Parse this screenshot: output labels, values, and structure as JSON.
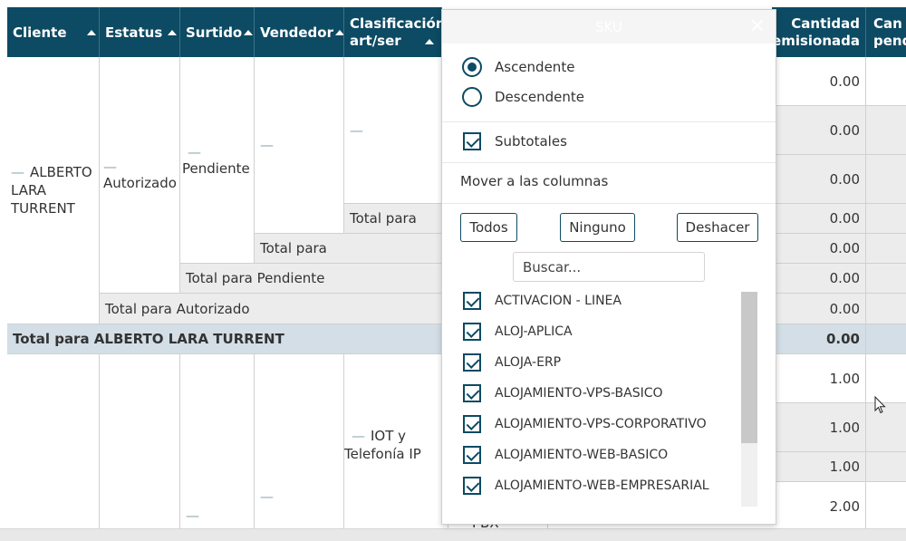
{
  "headers": [
    {
      "key": "cliente",
      "label": "Cliente"
    },
    {
      "key": "estatus",
      "label": "Estatus"
    },
    {
      "key": "surtido",
      "label": "Surtido"
    },
    {
      "key": "vendedor",
      "label": "Vendedor"
    },
    {
      "key": "clasificacion",
      "label": "Clasificación art/ser"
    },
    {
      "key": "cant_rem",
      "label": "Cantidad remisionada"
    },
    {
      "key": "cant_pend",
      "label": "Can pend"
    }
  ],
  "rows": {
    "cliente_name": "ALBERTO LARA TURRENT",
    "estatus_value": "Autorizado",
    "surtido_value": "Pendiente",
    "total_para_1": "Total para",
    "total_para_2": "Total para",
    "total_pendiente": "Total para Pendiente",
    "total_autorizado": "Total para Autorizado",
    "total_cliente": "Total para ALBERTO LARA TURRENT",
    "clasif_iot": "IOT y Telefonía IP",
    "partial_pbx": "PBX",
    "dash": "—",
    "cant_values_top": [
      "0.00",
      "0.00",
      "0.00",
      "0.00",
      "0.00",
      "0.00",
      "0.00"
    ],
    "cant_total_cliente": "0.00",
    "cant_values_bottom": [
      "1.00",
      "1.00",
      "1.00",
      "2.00"
    ]
  },
  "popup": {
    "title": "SKU",
    "sort_asc": "Ascendente",
    "sort_desc": "Descendente",
    "sort_selected": "asc",
    "subtotales": "Subtotales",
    "subtotales_checked": true,
    "move_to_columns": "Mover a las columnas",
    "btn_all": "Todos",
    "btn_none": "Ninguno",
    "btn_undo": "Deshacer",
    "search_placeholder": "Buscar...",
    "items": [
      "ACTIVACION - LINEA",
      "ALOJ-APLICA",
      "ALOJA-ERP",
      "ALOJAMIENTO-VPS-BASICO",
      "ALOJAMIENTO-VPS-CORPORATIVO",
      "ALOJAMIENTO-WEB-BASICO",
      "ALOJAMIENTO-WEB-EMPRESARIAL"
    ]
  },
  "colors": {
    "header_bg": "#0d4a63",
    "total_row_bg": "#d3dee6",
    "gray_row_bg": "#ececec"
  }
}
